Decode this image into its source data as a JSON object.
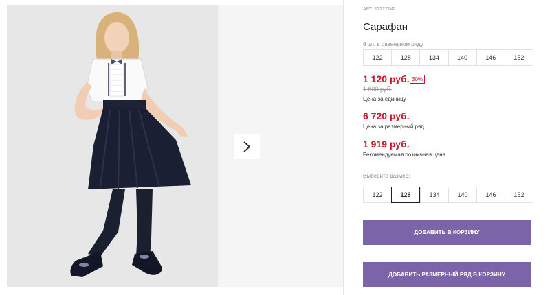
{
  "product": {
    "article": "АРТ. 22227142",
    "title": "Сарафан",
    "pack_caption": "6 шт. в размерном ряду",
    "pack_sizes": [
      "122",
      "128",
      "134",
      "140",
      "146",
      "152"
    ],
    "price": "1 120 руб.",
    "discount": "30%",
    "old_price": "1 600 руб.",
    "price_unit_label": "Цена за единицу",
    "pack_price": "6 720 руб.",
    "pack_price_label": "Цена за размерный ряд",
    "retail_price": "1 919 руб.",
    "retail_price_label": "Рекомендуемая розничная цена",
    "select_size_label": "Выберите размер:",
    "sizes": [
      "122",
      "128",
      "134",
      "140",
      "146",
      "152"
    ],
    "selected_size": "128",
    "add_to_cart": "Добавить в корзину",
    "add_pack_to_cart": "Добавить размерный ряд в корзину"
  },
  "gallery": {
    "next_icon": "chevron-right-icon"
  },
  "colors": {
    "price_red": "#d0142a",
    "button_purple": "#7b64a8",
    "skirt_navy": "#1a1f33"
  }
}
